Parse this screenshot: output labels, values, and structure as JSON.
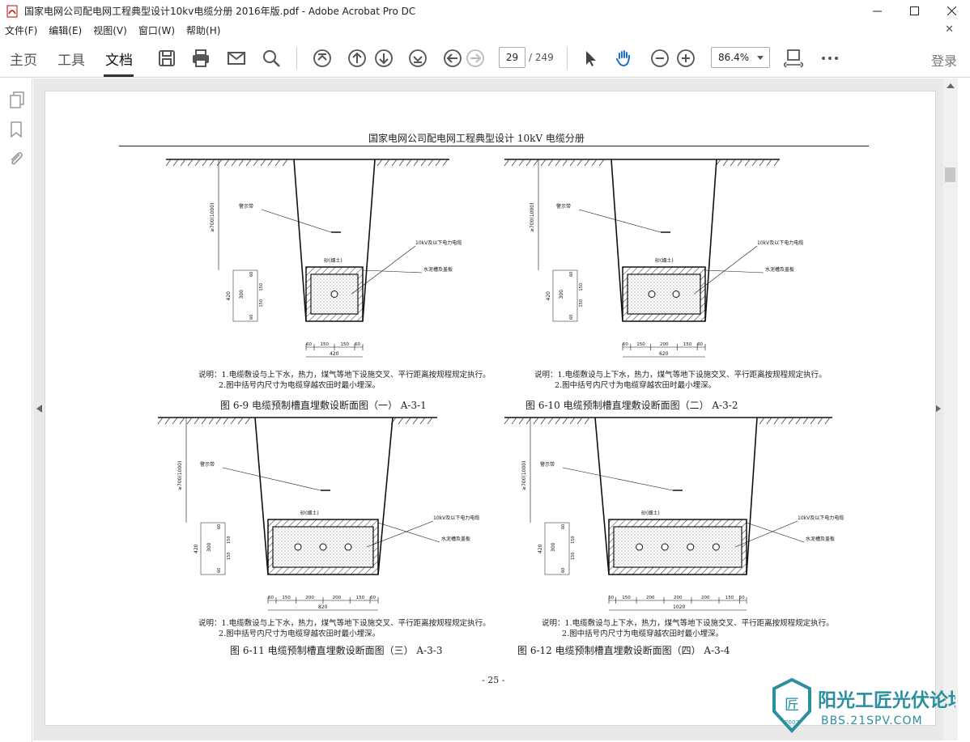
{
  "window": {
    "title": "国家电网公司配电网工程典型设计10kv电缆分册 2016年版.pdf - Adobe Acrobat Pro DC"
  },
  "menu": [
    "文件(F)",
    "编辑(E)",
    "视图(V)",
    "窗口(W)",
    "帮助(H)"
  ],
  "tabs": [
    "主页",
    "工具",
    "文档"
  ],
  "toolbar": {
    "page_current": "29",
    "page_total": "/ 249",
    "zoom": "86.4%",
    "login": "登录"
  },
  "doc": {
    "header": "国家电网公司配电网工程典型设计   10kV 电缆分册",
    "page_number": "- 25 -",
    "figures": [
      {
        "caption": "图 6-9  电缆预制槽直埋敷设断面图（一）  A-3-1",
        "labels": [
          "警示带",
          "砂(细土)",
          "10kV及以下电力电缆",
          "水泥槽及盖板"
        ],
        "depth": "≥700(1000)",
        "dims_v": [
          "420",
          "300",
          "60",
          "150",
          "150",
          "60"
        ],
        "dims_h": [
          "60",
          "150",
          "150",
          "60"
        ],
        "width": "420",
        "note1": "说明：1.电缆敷设与上下水，热力，煤气等地下设施交叉、平行距离按规程规定执行。",
        "note2": "2.图中括号内尺寸为电缆穿越农田时最小埋深。"
      },
      {
        "caption": "图 6-10  电缆预制槽直埋敷设断面图（二）  A-3-2",
        "labels": [
          "警示带",
          "砂(细土)",
          "10kV及以下电力电缆",
          "水泥槽及盖板"
        ],
        "depth": "≥700(1000)",
        "dims_v": [
          "420",
          "300",
          "60",
          "150",
          "150",
          "60"
        ],
        "dims_h": [
          "60",
          "150",
          "200",
          "150",
          "60"
        ],
        "width": "620",
        "note1": "说明：1.电缆敷设与上下水，热力，煤气等地下设施交叉、平行距离按规程规定执行。",
        "note2": "2.图中括号内尺寸为电缆穿越农田时最小埋深。"
      },
      {
        "caption": "图 6-11  电缆预制槽直埋敷设断面图（三）  A-3-3",
        "labels": [
          "警示带",
          "砂(细土)",
          "10kV及以下电力电缆",
          "水泥槽及盖板"
        ],
        "depth": "≥700(1000)",
        "dims_v": [
          "420",
          "300",
          "60",
          "150",
          "150",
          "60"
        ],
        "dims_h": [
          "60",
          "150",
          "200",
          "200",
          "150",
          "60"
        ],
        "width": "820",
        "note1": "说明：1.电缆敷设与上下水，热力，煤气等地下设施交叉、平行距离按规程规定执行。",
        "note2": "2.图中括号内尺寸为电缆穿越农田时最小埋深。"
      },
      {
        "caption": "图 6-12  电缆预制槽直埋敷设断面图（四）  A-3-4",
        "labels": [
          "警示带",
          "砂(细土)",
          "10kV及以下电力电缆",
          "水泥槽及盖板"
        ],
        "depth": "≥700(1000)",
        "dims_v": [
          "420",
          "300",
          "60",
          "150",
          "150",
          "60"
        ],
        "dims_h": [
          "50",
          "150",
          "200",
          "200",
          "200",
          "150",
          "50"
        ],
        "width": "1020",
        "note1": "说明：1.电缆敷设与上下水，热力，煤气等地下设施交叉、平行距离按规程规定执行。",
        "note2": "2.图中括号内尺寸为电缆穿越农田时最小埋深。"
      }
    ]
  },
  "watermark": {
    "text": "阳光工匠光伏论坛",
    "url": "BBS.21SPV.COM",
    "year": "2007",
    "color": "#2a8fa0"
  }
}
